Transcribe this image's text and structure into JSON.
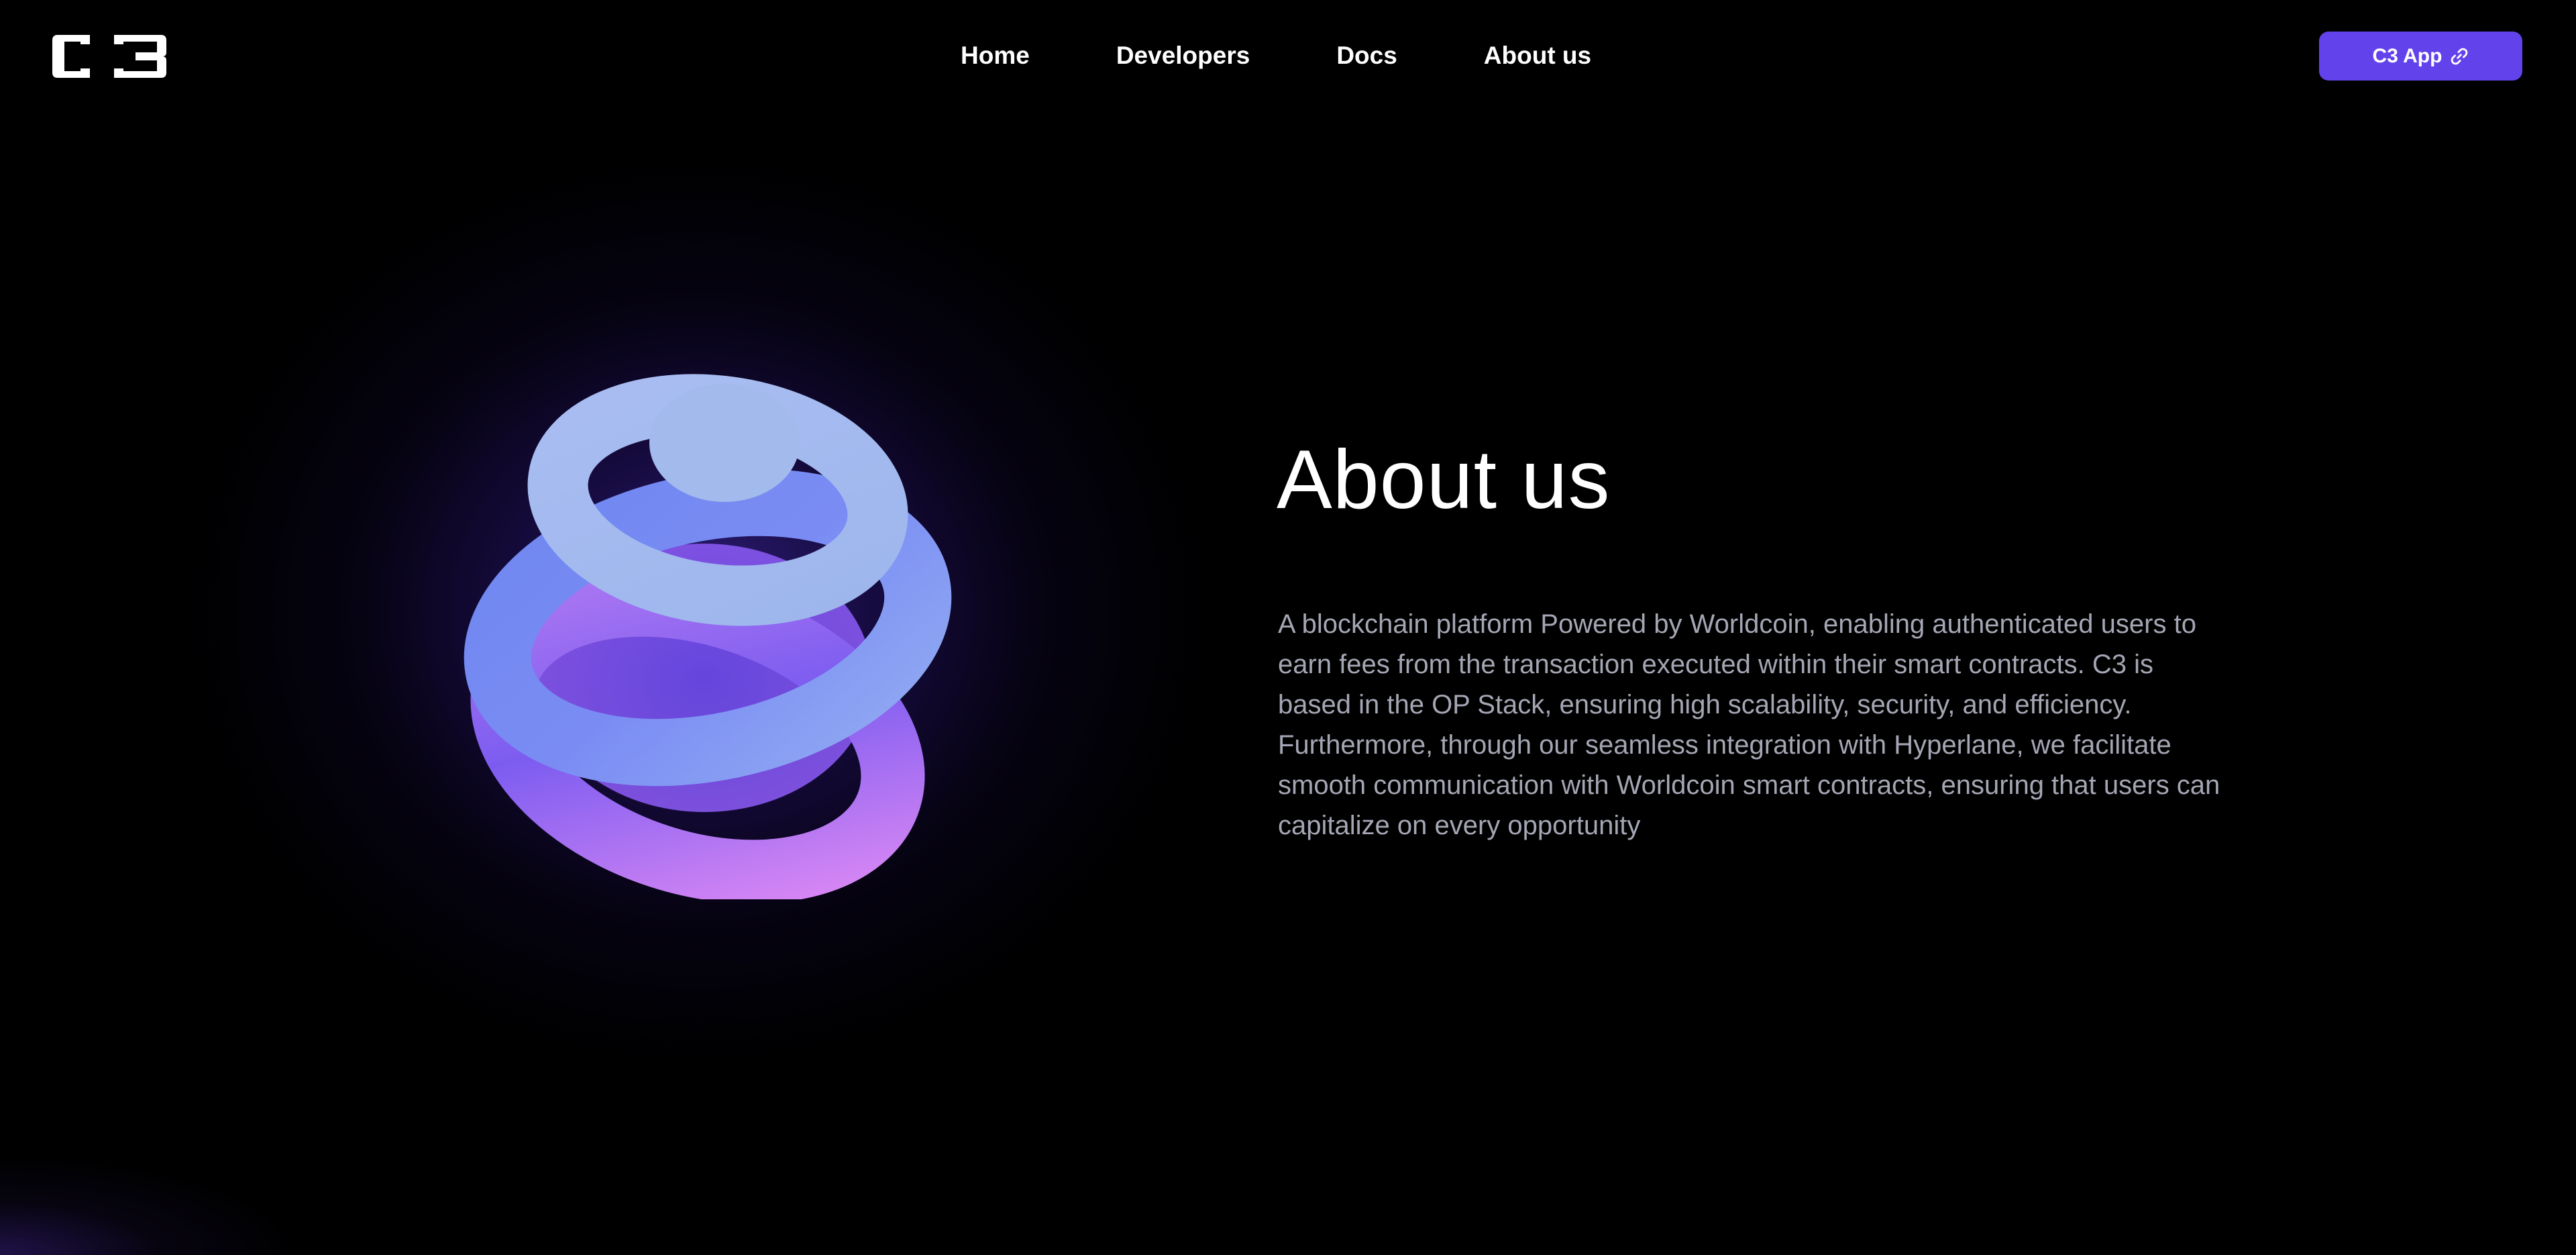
{
  "header": {
    "logo_text": "C3",
    "nav": [
      {
        "label": "Home"
      },
      {
        "label": "Developers"
      },
      {
        "label": "Docs"
      },
      {
        "label": "About us"
      }
    ],
    "app_button": {
      "label": "C3 App",
      "icon": "link-icon"
    }
  },
  "about": {
    "title": "About us",
    "description": "A blockchain platform Powered by Worldcoin, enabling authenticated users to earn fees from the transaction executed within their smart contracts. C3 is based in the OP Stack, ensuring high scalability, security, and efficiency. Furthermore, through our seamless integration with Hyperlane, we facilitate smooth communication with Worldcoin smart contracts, ensuring that users can capitalize on every opportunity"
  },
  "colors": {
    "background": "#000000",
    "accent": "#6243EB",
    "body_text": "#A4A6B4",
    "heading_text": "#FFFFFF"
  }
}
